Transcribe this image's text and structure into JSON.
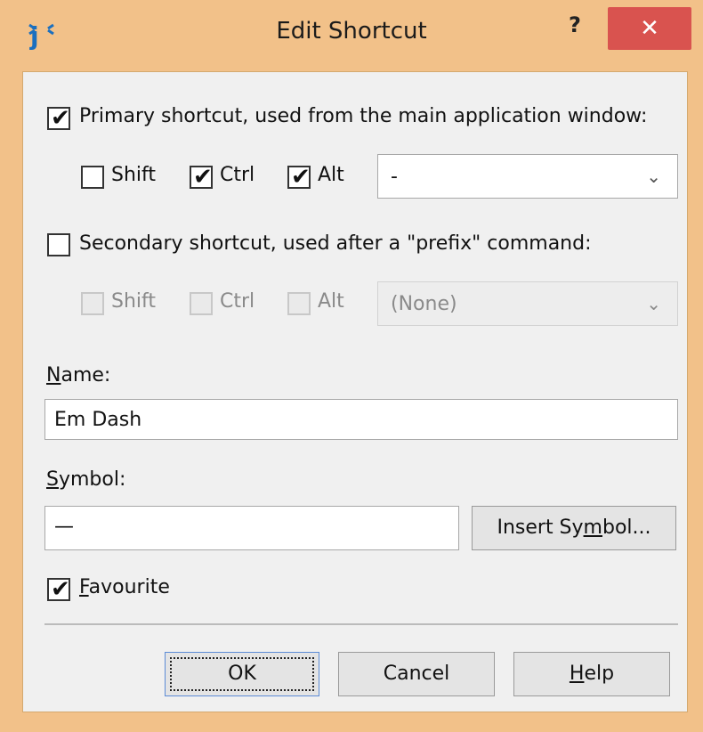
{
  "window": {
    "title": "Edit Shortcut",
    "help_glyph": "?",
    "close_glyph": "✕",
    "colors": {
      "title_bar": "#f2c189",
      "close": "#d9534f",
      "client": "#f0f0f0"
    }
  },
  "primary": {
    "checkbox_label": "Primary shortcut, used from the main application window:",
    "enabled": true,
    "modifiers": [
      {
        "label": "Shift",
        "checked": false
      },
      {
        "label": "Ctrl",
        "checked": true
      },
      {
        "label": "Alt",
        "checked": true
      }
    ],
    "key_value": "-"
  },
  "secondary": {
    "checkbox_label": "Secondary shortcut, used after a \"prefix\" command:",
    "enabled": false,
    "modifiers": [
      {
        "label": "Shift",
        "checked": false
      },
      {
        "label": "Ctrl",
        "checked": false
      },
      {
        "label": "Alt",
        "checked": false
      }
    ],
    "key_value": "(None)"
  },
  "name": {
    "label_first": "N",
    "label_rest": "ame:",
    "value": "Em Dash"
  },
  "symbol": {
    "label_first": "S",
    "label_rest": "ymbol:",
    "value": "—",
    "insert_button_pre": "Insert Sy",
    "insert_button_u": "m",
    "insert_button_post": "bol..."
  },
  "favourite": {
    "label_first": "F",
    "label_rest": "avourite",
    "checked": true
  },
  "buttons": {
    "ok": "OK",
    "cancel": "Cancel",
    "help_u": "H",
    "help_rest": "elp"
  },
  "check_glyph": "✔",
  "arrow_glyph": "⌄"
}
